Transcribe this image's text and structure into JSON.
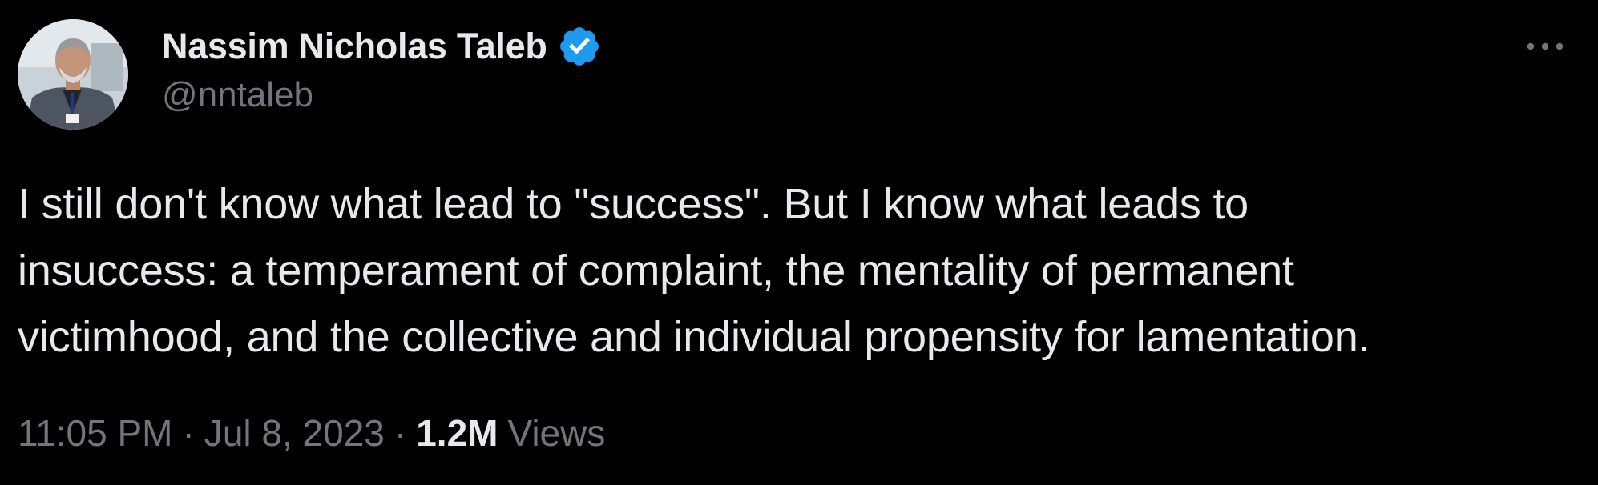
{
  "author": {
    "display_name": "Nassim Nicholas Taleb",
    "handle": "@nntaleb",
    "verified": true,
    "verified_color": "#1d9bf0"
  },
  "tweet": {
    "lines": [
      "I still don't know what lead to \"success\". But I know what leads to",
      "insuccess: a temperament of complaint, the mentality of permanent",
      "victimhood, and the collective and individual propensity for lamentation."
    ]
  },
  "meta": {
    "time": "11:05 PM",
    "separator": "·",
    "date": "Jul 8, 2023",
    "views_count": "1.2M",
    "views_label": "Views"
  },
  "icons": {
    "more": "more-icon",
    "verified": "verified-badge-icon",
    "avatar": "avatar"
  },
  "colors": {
    "background": "#000000",
    "primary_text": "#e7e9ea",
    "secondary_text": "#71767b"
  }
}
